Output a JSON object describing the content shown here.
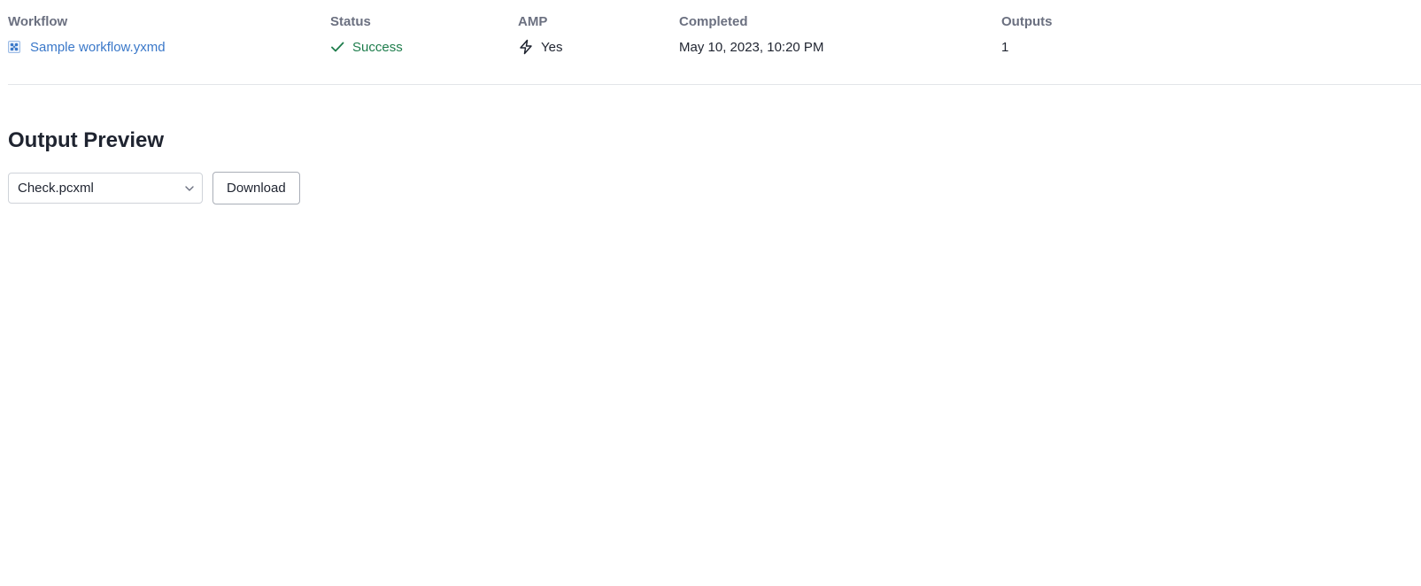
{
  "table": {
    "headers": {
      "workflow": "Workflow",
      "status": "Status",
      "amp": "AMP",
      "completed": "Completed",
      "outputs": "Outputs"
    },
    "row": {
      "workflow_name": "Sample workflow.yxmd",
      "workflow_icon": "workflow-file-icon",
      "status": "Success",
      "status_icon": "check-icon",
      "amp": "Yes",
      "amp_icon": "lightning-bolt-icon",
      "completed": "May 10, 2023, 10:20 PM",
      "outputs": "1"
    }
  },
  "output_preview": {
    "title": "Output Preview",
    "selected_file": "Check.pcxml",
    "download_label": "Download"
  },
  "colors": {
    "link": "#3a78c9",
    "success": "#1e7d4c",
    "header_text": "#6b7080",
    "body_text": "#1f2430",
    "divider": "#e3e5e9"
  }
}
